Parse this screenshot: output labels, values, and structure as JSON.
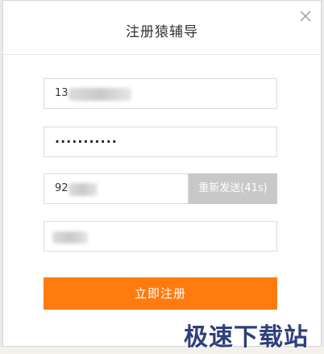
{
  "dialog": {
    "title": "注册猿辅导",
    "close_icon": "close-icon"
  },
  "form": {
    "phone_value_prefix": "13",
    "password_mask": "···········",
    "code_value_prefix": "92",
    "resend_label": "重新发送(41s)",
    "submit_label": "立即注册"
  },
  "watermark": {
    "text": "极速下载站"
  },
  "colors": {
    "accent": "#ff7b0f",
    "resend_bg": "#c8c8c8",
    "border": "#dcdcdc"
  }
}
